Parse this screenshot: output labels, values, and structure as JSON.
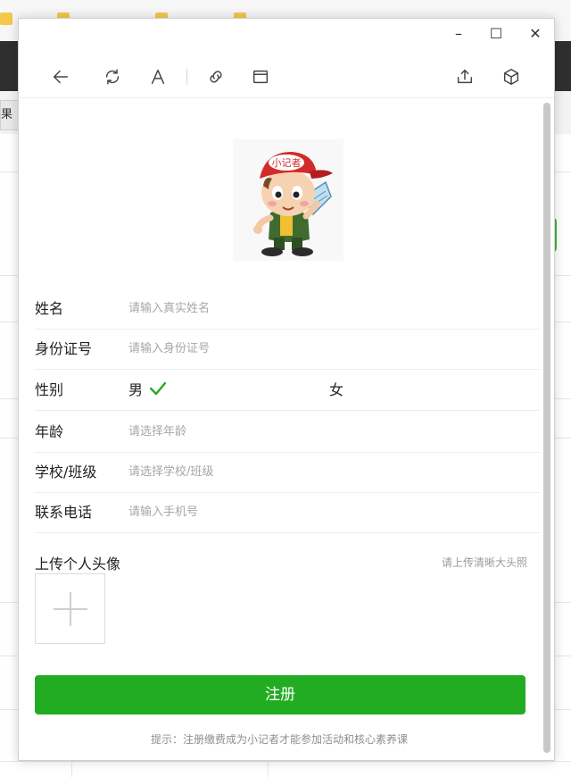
{
  "background": {
    "sidebar_text": "果列"
  },
  "window": {
    "controls": {
      "minimize": "–",
      "maximize": "☐",
      "close": "✕"
    },
    "toolbar_icons": [
      "back-arrow-icon",
      "refresh-icon",
      "font-icon",
      "link-icon",
      "window-icon",
      "share-icon",
      "cube-icon"
    ]
  },
  "mascot": {
    "cap_text": "小记者"
  },
  "form": {
    "fields": [
      {
        "label": "姓名",
        "placeholder": "请输入真实姓名"
      },
      {
        "label": "身份证号",
        "placeholder": "请输入身份证号"
      },
      {
        "label": "性别",
        "option_male": "男",
        "option_female": "女",
        "selected": "男"
      },
      {
        "label": "年龄",
        "placeholder": "请选择年龄"
      },
      {
        "label": "学校/班级",
        "placeholder": "请选择学校/班级"
      },
      {
        "label": "联系电话",
        "placeholder": "请输入手机号"
      }
    ],
    "upload": {
      "title": "上传个人头像",
      "hint": "请上传清晰大头照"
    },
    "submit_label": "注册",
    "tip": "提示：注册缴费成为小记者才能参加活动和核心素养课"
  },
  "colors": {
    "primary": "#22ac22",
    "check": "#22ac22"
  }
}
